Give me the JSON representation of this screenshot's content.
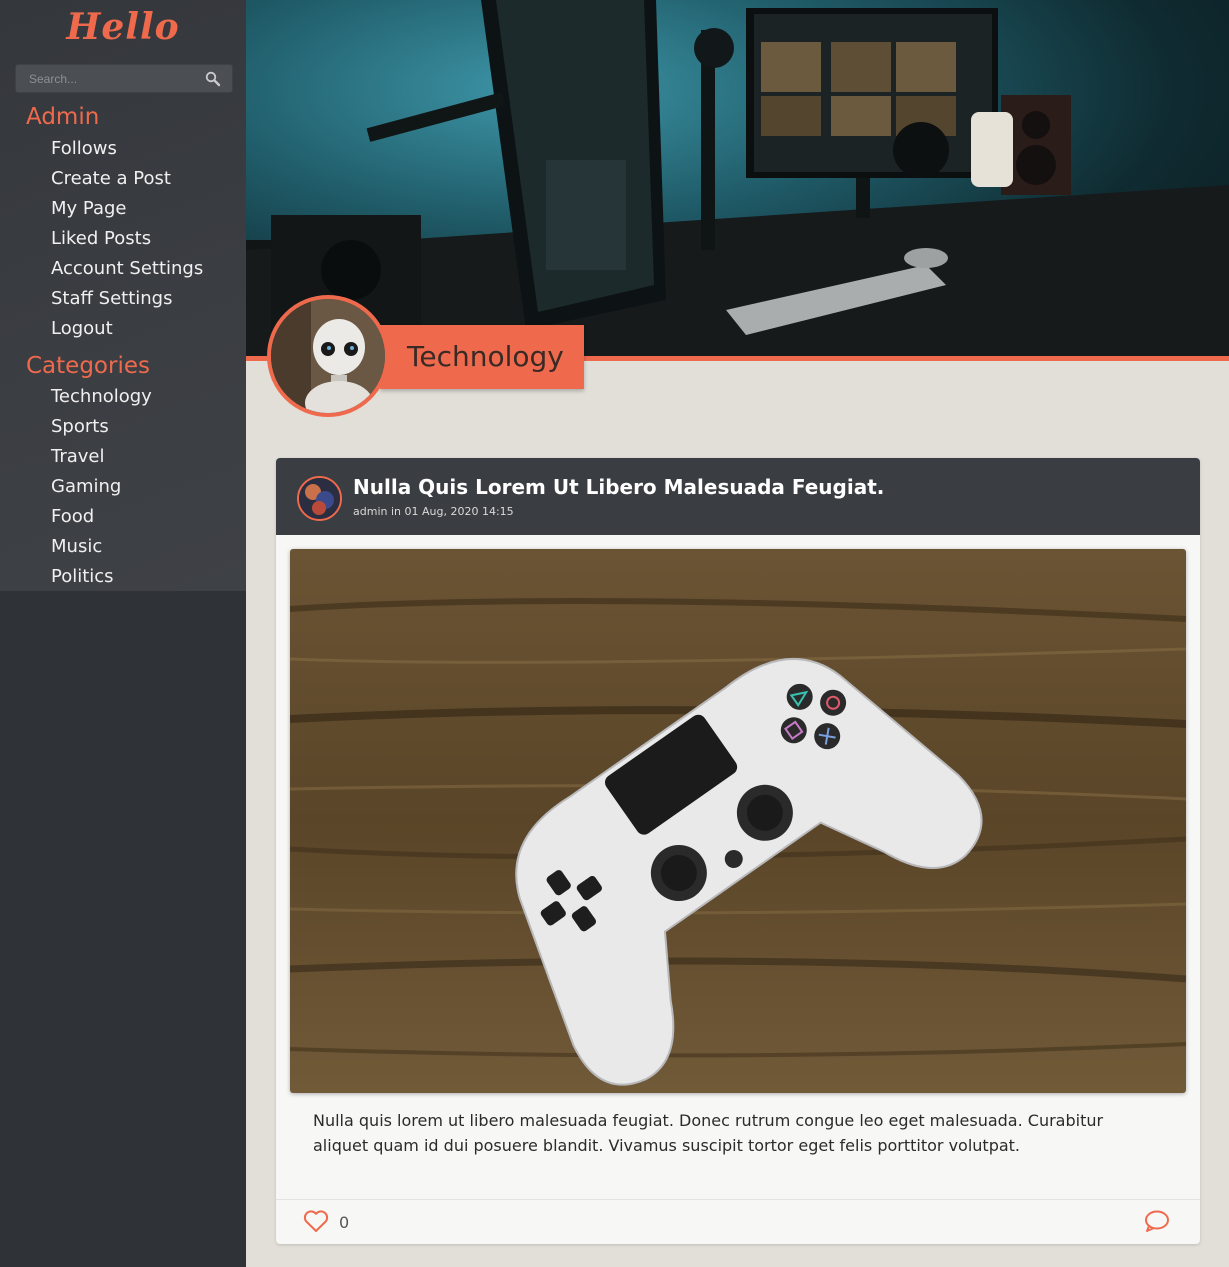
{
  "sidebar": {
    "logo": "Hello",
    "search": {
      "placeholder": "Search..."
    },
    "admin_heading": "Admin",
    "admin_items": [
      "Follows",
      "Create a Post",
      "My Page",
      "Liked Posts",
      "Account Settings",
      "Staff Settings",
      "Logout"
    ],
    "categories_heading": "Categories",
    "category_items": [
      "Technology",
      "Sports",
      "Travel",
      "Gaming",
      "Food",
      "Music",
      "Politics"
    ]
  },
  "header": {
    "category_title": "Technology",
    "banner_image": "desk-monitors-photo",
    "avatar_image": "robot-photo"
  },
  "post": {
    "title": "Nulla Quis Lorem Ut Libero Malesuada Feugiat.",
    "meta": "admin in 01 Aug, 2020 14:15",
    "image": "white-game-controller-on-wood-photo",
    "body": "Nulla quis lorem ut libero malesuada feugiat. Donec rutrum congue leo eget malesuada. Curabitur aliquet quam id dui posuere blandit. Vivamus suscipit tortor eget felis porttitor volutpat.",
    "like_count": "0",
    "icons": {
      "like": "heart-icon",
      "comment": "comment-icon"
    }
  },
  "colors": {
    "accent": "#ef6a4d",
    "sidebar_bg": "#2f3237",
    "page_bg": "#e2dfd8",
    "post_header_bg": "#3a3d41"
  }
}
